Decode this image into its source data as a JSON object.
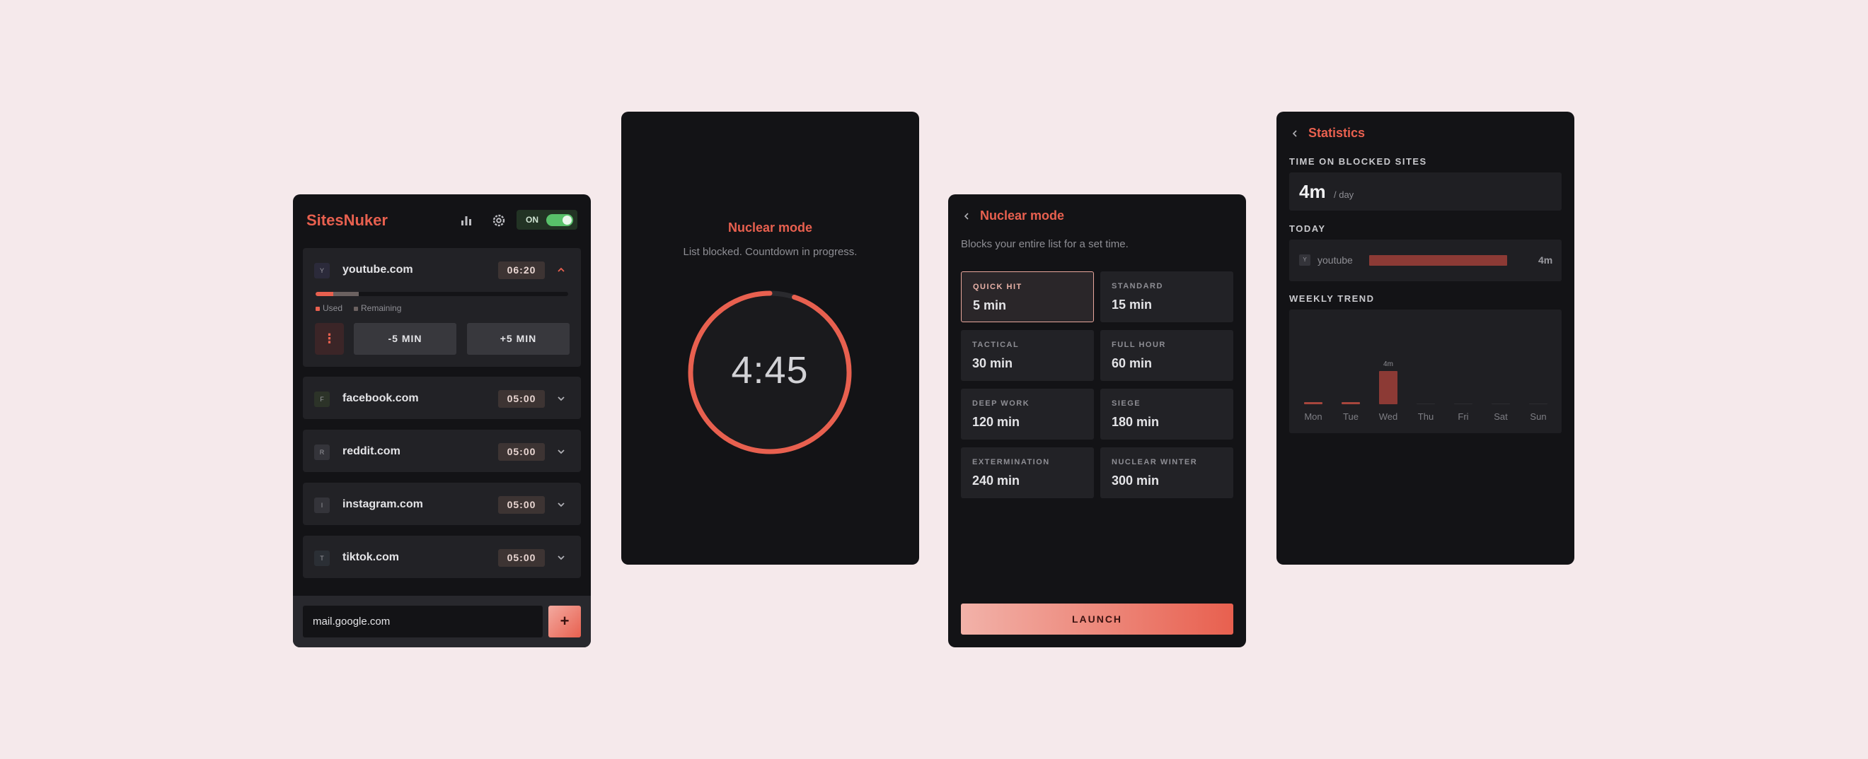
{
  "app": {
    "logo": "SitesNuker",
    "toggle_label": "ON"
  },
  "sites": [
    {
      "initial": "Y",
      "name": "youtube.com",
      "time": "06:20",
      "expanded": true,
      "favicon_color": "#2b2a3a"
    },
    {
      "initial": "F",
      "name": "facebook.com",
      "time": "05:00",
      "expanded": false,
      "favicon_color": "#2c3328"
    },
    {
      "initial": "R",
      "name": "reddit.com",
      "time": "05:00",
      "expanded": false,
      "favicon_color": "#34343a"
    },
    {
      "initial": "I",
      "name": "instagram.com",
      "time": "05:00",
      "expanded": false,
      "favicon_color": "#34343a"
    },
    {
      "initial": "T",
      "name": "tiktok.com",
      "time": "05:00",
      "expanded": false,
      "favicon_color": "#2b2f35"
    }
  ],
  "expanded_site": {
    "used_fraction": 0.07,
    "remaining_fraction": 0.1,
    "legend_used": "Used",
    "legend_remaining": "Remaining",
    "minus_label": "-5 MIN",
    "plus_label": "+5 MIN",
    "kebab": "⋮"
  },
  "add_site": {
    "input_value": "mail.google.com",
    "button_label": "+"
  },
  "countdown": {
    "title": "Nuclear mode",
    "subtitle": "List blocked. Countdown in progress.",
    "time": "4:45",
    "progress_fraction": 0.95
  },
  "nuclear": {
    "back_icon": "chevron-left",
    "title": "Nuclear mode",
    "description": "Blocks your entire list for a set time.",
    "presets": [
      {
        "label": "QUICK HIT",
        "value": "5 min",
        "selected": true
      },
      {
        "label": "STANDARD",
        "value": "15 min",
        "selected": false
      },
      {
        "label": "TACTICAL",
        "value": "30 min",
        "selected": false
      },
      {
        "label": "FULL HOUR",
        "value": "60 min",
        "selected": false
      },
      {
        "label": "DEEP WORK",
        "value": "120 min",
        "selected": false
      },
      {
        "label": "SIEGE",
        "value": "180 min",
        "selected": false
      },
      {
        "label": "EXTERMINATION",
        "value": "240 min",
        "selected": false
      },
      {
        "label": "NUCLEAR WINTER",
        "value": "300 min",
        "selected": false
      }
    ],
    "launch_label": "LAUNCH"
  },
  "stats": {
    "title": "Statistics",
    "time_section": "TIME ON BLOCKED SITES",
    "per_day_value": "4m",
    "per_day_unit": "/ day",
    "today_section": "TODAY",
    "today_site_initial": "Y",
    "today_site": "youtube",
    "today_value": "4m",
    "today_fraction": 1.0,
    "weekly_section": "WEEKLY TREND",
    "colors": {
      "accent": "#e8604f",
      "bar": "#8c3a35"
    }
  },
  "chart_data": {
    "type": "bar",
    "categories": [
      "Mon",
      "Tue",
      "Wed",
      "Thu",
      "Fri",
      "Sat",
      "Sun"
    ],
    "values": [
      0.3,
      0.3,
      4,
      0,
      0,
      0,
      0
    ],
    "data_labels": [
      "",
      "",
      "4m",
      "",
      "",
      "",
      ""
    ],
    "title": "WEEKLY TREND",
    "ylabel": "",
    "ylim": [
      0,
      12
    ],
    "grid": false
  }
}
